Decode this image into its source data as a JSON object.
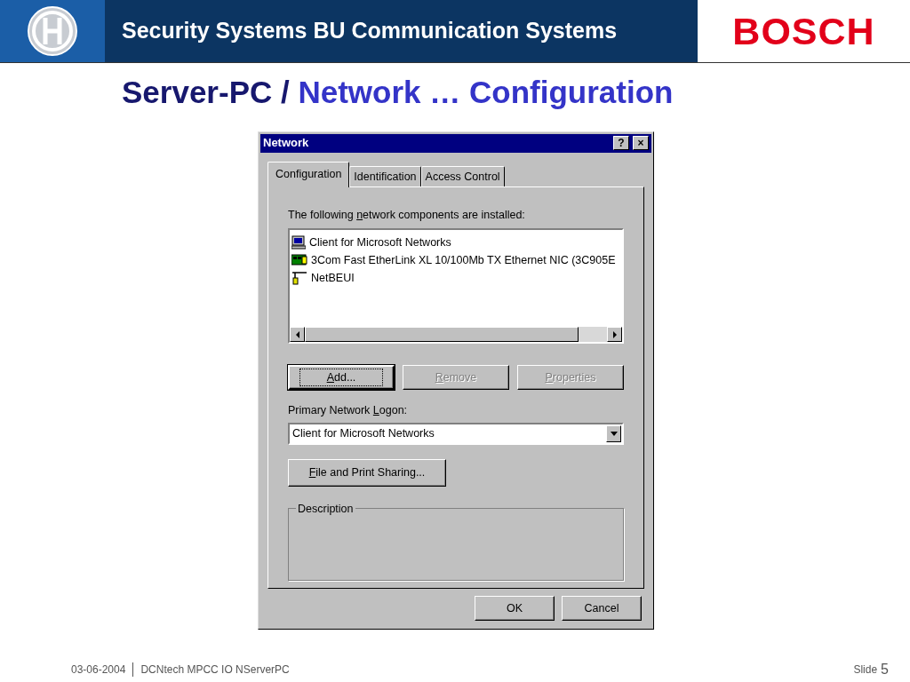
{
  "header": {
    "title": "Security Systems BU Communication Systems",
    "brand": "BOSCH"
  },
  "slide_title": [
    {
      "text": "Server-PC /",
      "kind": "main"
    },
    {
      "text": "Network … Configuration",
      "kind": "sub"
    }
  ],
  "window": {
    "title": "Network",
    "title_buttons": [
      "?",
      "×"
    ]
  },
  "tabs": [
    {
      "label": "Configuration",
      "selected": true
    },
    {
      "label": "Identification",
      "selected": false
    },
    {
      "label": "Access Control",
      "selected": false
    }
  ],
  "components_label": {
    "text": {
      "before": "The following ",
      "key": "n",
      "after": "etwork components are installed:"
    }
  },
  "components": [
    {
      "name": "Client for Microsoft Networks",
      "kind": "client"
    },
    {
      "name": "3Com Fast EtherLink XL 10/100Mb TX Ethernet NIC (3C905E",
      "kind": "adapter"
    },
    {
      "name": "NetBEUI",
      "kind": "protocol"
    }
  ],
  "component_buttons": [
    {
      "label": {
        "key": "A",
        "after": "dd..."
      },
      "disabled": false,
      "default": true
    },
    {
      "label": {
        "key": "R",
        "after": "emove"
      },
      "disabled": true,
      "default": false
    },
    {
      "label": {
        "key": "P",
        "after": "roperties"
      },
      "disabled": true,
      "default": false
    }
  ],
  "logon": {
    "label": {
      "before": "Primary Network ",
      "key": "L",
      "after": "ogon:"
    },
    "value": "Client for Microsoft Networks"
  },
  "sharing_button": {
    "label": {
      "key": "F",
      "after": "ile and Print Sharing..."
    }
  },
  "description": {
    "label": "Description"
  },
  "dialog_buttons": [
    "OK",
    "Cancel"
  ],
  "footer": {
    "date": "03-06-2004",
    "doc": "DCNtech MPCC IO NServerPC",
    "slide_label": "Slide",
    "slide_number": "5"
  }
}
